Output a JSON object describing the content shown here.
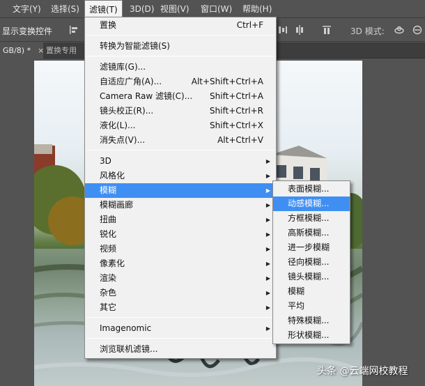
{
  "menubar": {
    "items": [
      {
        "label": "文字(Y)"
      },
      {
        "label": "选择(S)"
      },
      {
        "label": "滤镜(T)"
      },
      {
        "label": "3D(D)"
      },
      {
        "label": "视图(V)"
      },
      {
        "label": "窗口(W)"
      },
      {
        "label": "帮助(H)"
      }
    ]
  },
  "options_bar": {
    "label": "显示变换控件",
    "mode_3d_label": "3D 模式:"
  },
  "tabs": [
    {
      "label": "GB/8) *",
      "close": "×"
    },
    {
      "label": "置换专用",
      "close": ""
    }
  ],
  "filter_menu": {
    "items": [
      {
        "label": "置换",
        "shortcut": "Ctrl+F"
      },
      {
        "label": "转换为智能滤镜(S)",
        "shortcut": ""
      },
      {
        "label": "滤镜库(G)...",
        "shortcut": ""
      },
      {
        "label": "自适应广角(A)...",
        "shortcut": "Alt+Shift+Ctrl+A"
      },
      {
        "label": "Camera Raw 滤镜(C)...",
        "shortcut": "Shift+Ctrl+A"
      },
      {
        "label": "镜头校正(R)...",
        "shortcut": "Shift+Ctrl+R"
      },
      {
        "label": "液化(L)...",
        "shortcut": "Shift+Ctrl+X"
      },
      {
        "label": "消失点(V)...",
        "shortcut": "Alt+Ctrl+V"
      },
      {
        "label": "3D",
        "shortcut": ""
      },
      {
        "label": "风格化",
        "shortcut": ""
      },
      {
        "label": "模糊",
        "shortcut": ""
      },
      {
        "label": "模糊画廊",
        "shortcut": ""
      },
      {
        "label": "扭曲",
        "shortcut": ""
      },
      {
        "label": "锐化",
        "shortcut": ""
      },
      {
        "label": "视频",
        "shortcut": ""
      },
      {
        "label": "像素化",
        "shortcut": ""
      },
      {
        "label": "渲染",
        "shortcut": ""
      },
      {
        "label": "杂色",
        "shortcut": ""
      },
      {
        "label": "其它",
        "shortcut": ""
      },
      {
        "label": "Imagenomic",
        "shortcut": ""
      },
      {
        "label": "浏览联机滤镜...",
        "shortcut": ""
      }
    ]
  },
  "blur_submenu": {
    "items": [
      {
        "label": "表面模糊..."
      },
      {
        "label": "动感模糊..."
      },
      {
        "label": "方框模糊..."
      },
      {
        "label": "高斯模糊..."
      },
      {
        "label": "进一步模糊"
      },
      {
        "label": "径向模糊..."
      },
      {
        "label": "镜头模糊..."
      },
      {
        "label": "模糊"
      },
      {
        "label": "平均"
      },
      {
        "label": "特殊模糊..."
      },
      {
        "label": "形状模糊..."
      }
    ]
  },
  "watermark": "头条 @云端网校教程",
  "colors": {
    "highlight": "#3f8ff3",
    "menu_bg": "#f1f1f1",
    "chrome_bg": "#535353"
  }
}
